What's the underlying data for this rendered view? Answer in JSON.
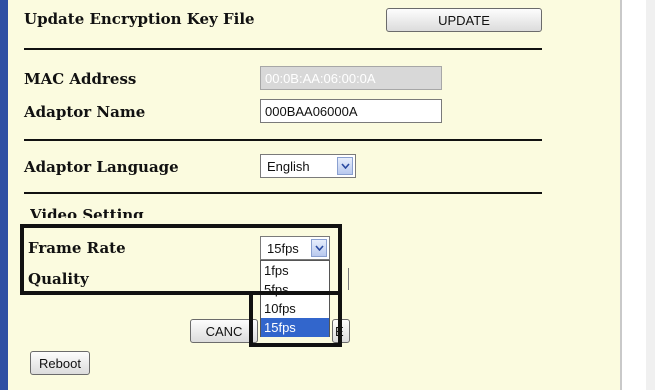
{
  "encryption": {
    "label": "Update Encryption Key File",
    "update_button": "UPDATE"
  },
  "mac": {
    "label": "MAC Address",
    "value": "00:0B:AA:06:00:0A"
  },
  "adaptor_name": {
    "label": "Adaptor Name",
    "value": "000BAA06000A"
  },
  "language": {
    "label": "Adaptor Language",
    "selected": "English"
  },
  "video": {
    "heading": "Video Setting",
    "frame_rate_label": "Frame Rate",
    "frame_rate_selected": "15fps",
    "frame_rate_options": [
      "1fps",
      "5fps",
      "10fps",
      "15fps"
    ],
    "quality_label": "Quality"
  },
  "buttons": {
    "cancel_partial": "CANC",
    "save_partial": "E",
    "reboot": "Reboot"
  },
  "colors": {
    "panel_bg": "#fbfbdf",
    "left_edge": "#2e4fa3",
    "selected_option": "#3266cc"
  },
  "icons": {
    "select_arrow": "chevron-down-icon"
  }
}
